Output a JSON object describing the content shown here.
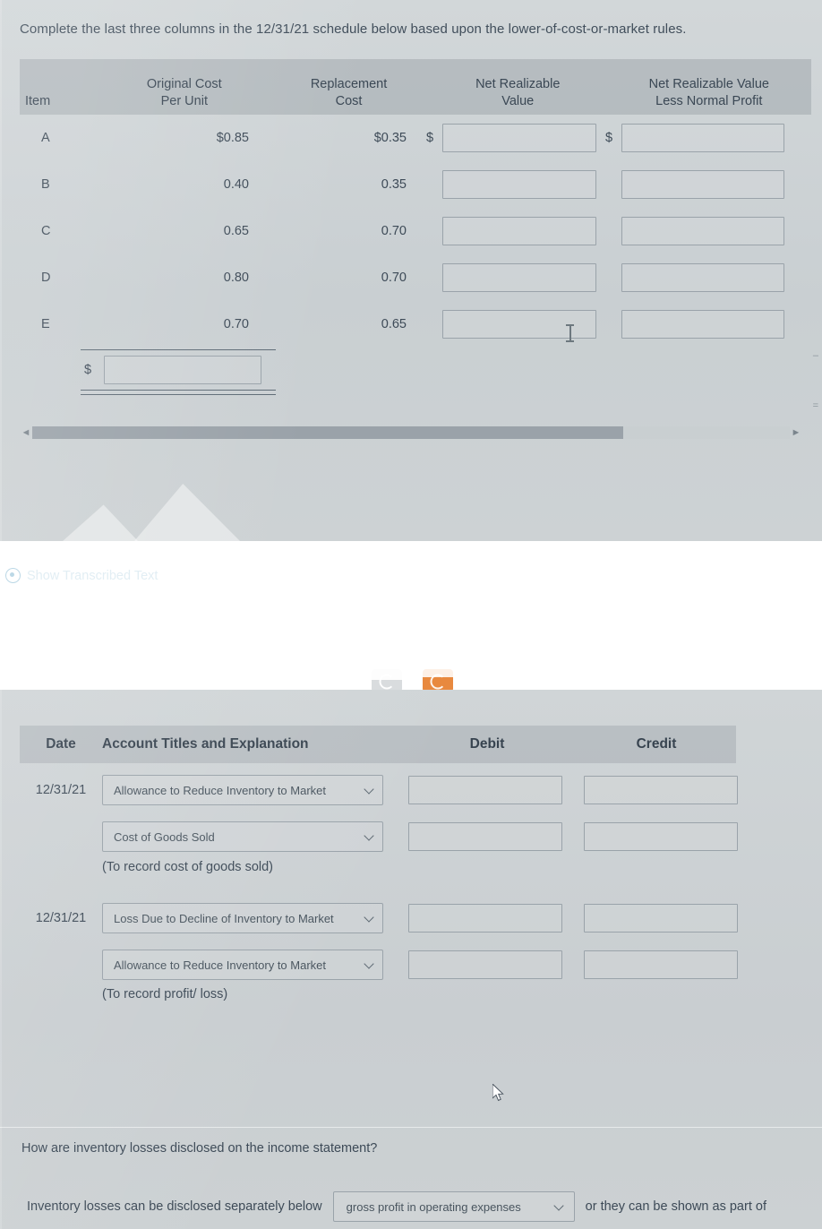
{
  "schedule": {
    "prompt": "Complete the last three columns in the 12/31/21 schedule below based upon the lower-of-cost-or-market rules.",
    "columns": {
      "item": "Item",
      "original_cost_line1": "Original Cost",
      "original_cost_line2": "Per Unit",
      "replacement_line1": "Replacement",
      "replacement_line2": "Cost",
      "nrv_line1": "Net Realizable",
      "nrv_line2": "Value",
      "nrvlnp_line1": "Net Realizable Value",
      "nrvlnp_line2": "Less Normal Profit"
    },
    "rows": [
      {
        "item": "A",
        "original_cost": "$0.85",
        "replacement_cost": "$0.35",
        "nrv_prefix": "$",
        "nrv_value": "",
        "nrvlnp_prefix": "$",
        "nrvlnp_value": ""
      },
      {
        "item": "B",
        "original_cost": "0.40",
        "replacement_cost": "0.35",
        "nrv_prefix": "",
        "nrv_value": "",
        "nrvlnp_prefix": "",
        "nrvlnp_value": ""
      },
      {
        "item": "C",
        "original_cost": "0.65",
        "replacement_cost": "0.70",
        "nrv_prefix": "",
        "nrv_value": "",
        "nrvlnp_prefix": "",
        "nrvlnp_value": ""
      },
      {
        "item": "D",
        "original_cost": "0.80",
        "replacement_cost": "0.70",
        "nrv_prefix": "",
        "nrv_value": "",
        "nrvlnp_prefix": "",
        "nrvlnp_value": ""
      },
      {
        "item": "E",
        "original_cost": "0.70",
        "replacement_cost": "0.65",
        "nrv_prefix": "",
        "nrv_value": "",
        "nrvlnp_prefix": "",
        "nrvlnp_value": ""
      }
    ],
    "total": {
      "prefix": "$",
      "value": ""
    },
    "scrollbar": {
      "left_arrow": "◄",
      "right_arrow": "►"
    }
  },
  "transcribed": {
    "label": "Show Transcribed Text",
    "icon": "eye-icon"
  },
  "journal": {
    "columns": {
      "date": "Date",
      "account": "Account Titles and Explanation",
      "debit": "Debit",
      "credit": "Credit"
    },
    "entries": [
      {
        "date": "12/31/21",
        "account": "Allowance to Reduce Inventory to Market",
        "debit": "",
        "credit": ""
      },
      {
        "date": "",
        "account": "Cost of Goods Sold",
        "debit": "",
        "credit": ""
      }
    ],
    "note1": "(To record cost of goods sold)",
    "entries2": [
      {
        "date": "12/31/21",
        "account": "Loss Due to Decline of Inventory to Market",
        "debit": "",
        "credit": ""
      },
      {
        "date": "",
        "account": "Allowance to Reduce Inventory to Market",
        "debit": "",
        "credit": ""
      }
    ],
    "note2": "(To record profit/ loss)"
  },
  "question": {
    "prompt": "How are inventory losses disclosed on the income statement?",
    "answer_prefix": "Inventory losses can be disclosed separately below",
    "selected_option": "gross profit in operating expenses",
    "answer_suffix": "or they can be shown as part of"
  },
  "colors": {
    "panel_bg": "#cdd2d4",
    "header_band": "#a3aaaf",
    "text": "#3d4a57",
    "link": "#e2eef4",
    "accent_orange": "#e8893f"
  }
}
